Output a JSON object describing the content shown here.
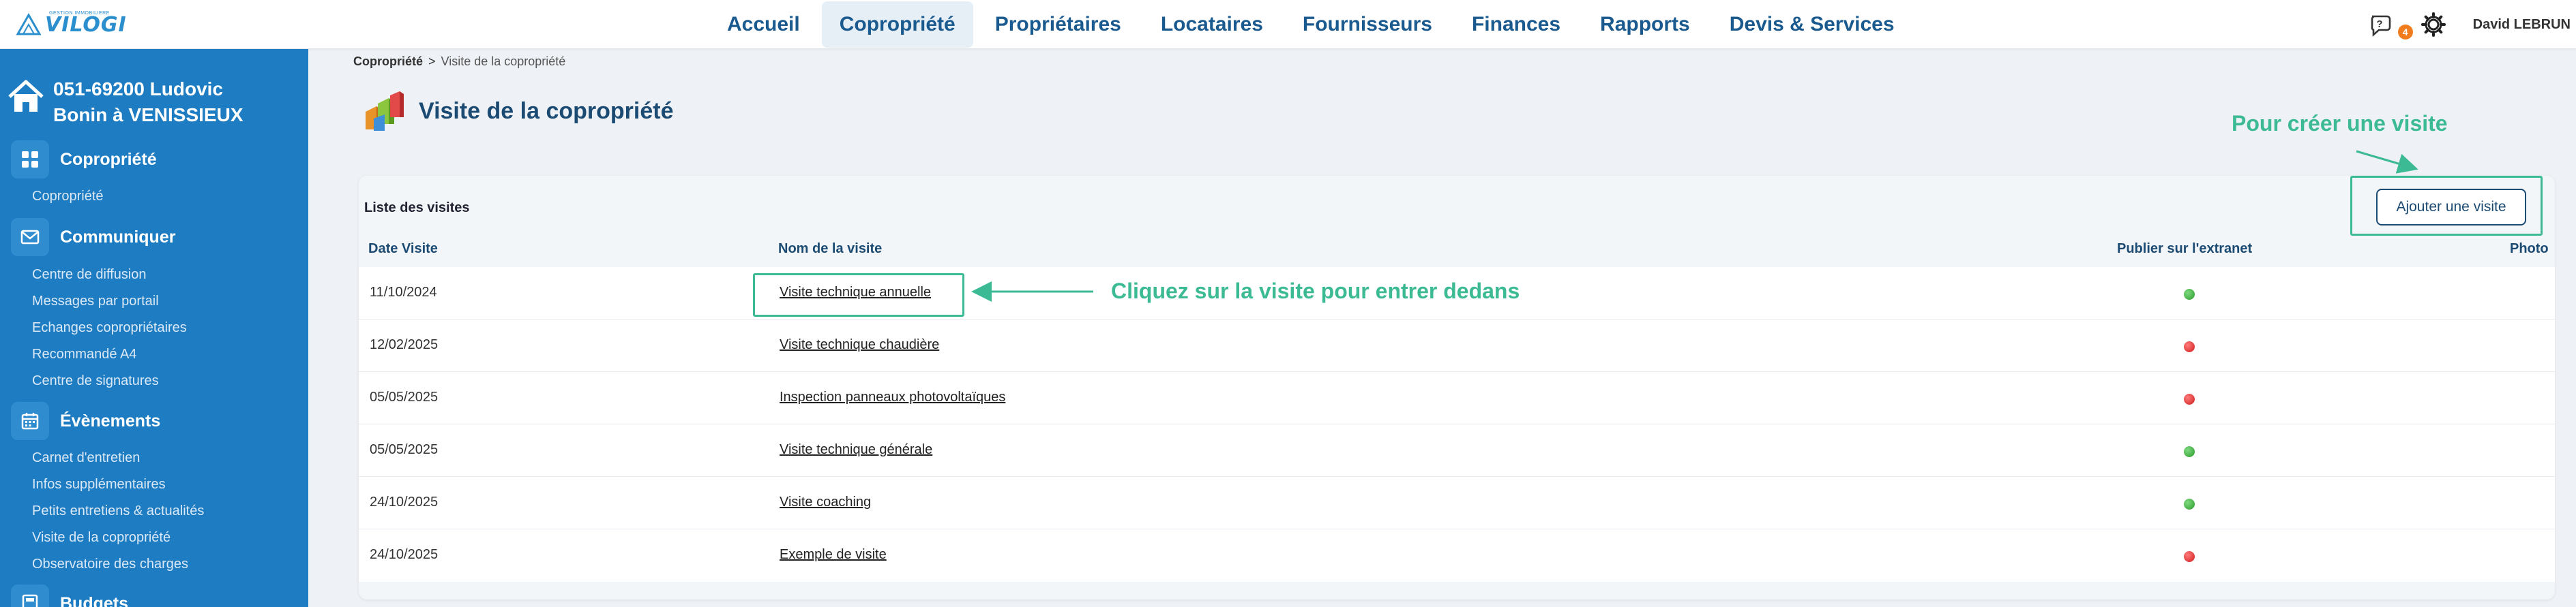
{
  "topbar": {
    "logo_text": "VILOGI",
    "logo_sub": "GESTION IMMOBILIERE",
    "nav": [
      "Accueil",
      "Copropriété",
      "Propriétaires",
      "Locataires",
      "Fournisseurs",
      "Finances",
      "Rapports",
      "Devis & Services"
    ],
    "active_nav": "Copropriété",
    "notification_count": "4",
    "user_name": "David LEBRUN"
  },
  "sidebar": {
    "property_line1": "051-69200 Ludovic",
    "property_line2": "Bonin à VENISSIEUX",
    "sections": [
      {
        "label": "Copropriété",
        "icon": "grid-icon",
        "items": [
          "Copropriété"
        ]
      },
      {
        "label": "Communiquer",
        "icon": "envelope-icon",
        "items": [
          "Centre de diffusion",
          "Messages par portail",
          "Echanges copropriétaires",
          "Recommandé A4",
          "Centre de signatures"
        ]
      },
      {
        "label": "Évènements",
        "icon": "calendar-icon",
        "items": [
          "Carnet d'entretien",
          "Infos supplémentaires",
          "Petits entretiens & actualités",
          "Visite de la copropriété",
          "Observatoire des charges"
        ]
      },
      {
        "label": "Budgets",
        "icon": "calculator-icon",
        "items": []
      }
    ]
  },
  "breadcrumb": {
    "parent": "Copropriété",
    "separator": ">",
    "current": "Visite de la copropriété"
  },
  "page_title": "Visite de la copropriété",
  "list": {
    "title": "Liste des visites",
    "add_button": "Ajouter une visite",
    "columns": [
      "Date Visite",
      "Nom de la visite",
      "Publier sur l'extranet",
      "Photo"
    ],
    "rows": [
      {
        "date": "11/10/2024",
        "name": "Visite technique annuelle",
        "published": true
      },
      {
        "date": "12/02/2025",
        "name": "Visite technique chaudière",
        "published": false
      },
      {
        "date": "05/05/2025",
        "name": "Inspection panneaux photovoltaïques",
        "published": false
      },
      {
        "date": "05/05/2025",
        "name": "Visite technique générale",
        "published": true
      },
      {
        "date": "24/10/2025",
        "name": "Visite coaching",
        "published": true
      },
      {
        "date": "24/10/2025",
        "name": "Exemple de visite",
        "published": false
      }
    ]
  },
  "annotations": {
    "create_hint": "Pour créer une visite",
    "click_hint": "Cliquez sur la visite pour entrer dedans"
  },
  "colors": {
    "sidebar": "#1e7cc2",
    "nav_text": "#1b5a8e",
    "annotation": "#3cba94",
    "published_on": "#2a9b2a",
    "published_off": "#d11c1c"
  }
}
